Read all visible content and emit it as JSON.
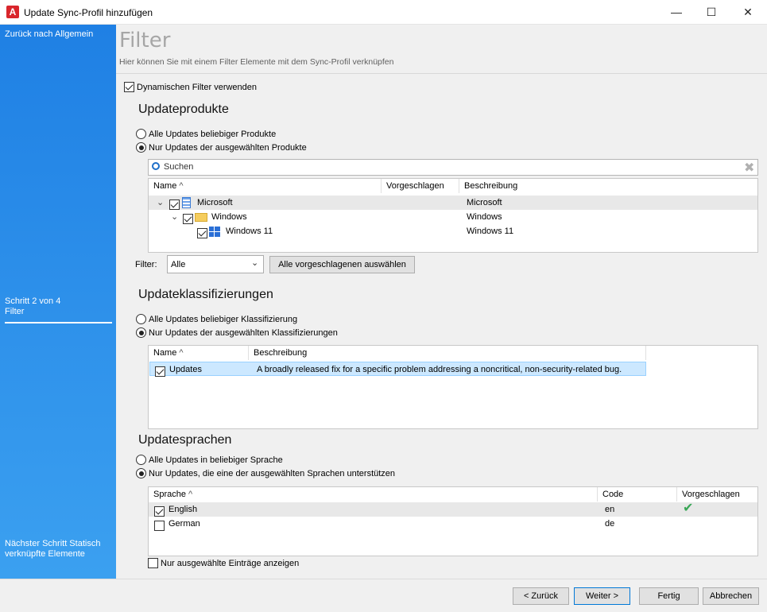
{
  "window": {
    "title": "Update Sync-Profil hinzufügen",
    "minimize": "—",
    "maximize": "☐",
    "close": "✕"
  },
  "sidebar": {
    "back_label": "Zurück nach Allgemein",
    "step_label": "Schritt 2 von 4",
    "step_name": "Filter",
    "next_label": "Nächster Schritt Statisch verknüpfte Elemente"
  },
  "header": {
    "title": "Filter",
    "subtitle": "Hier können Sie mit einem Filter Elemente mit dem Sync-Profil verknüpfen"
  },
  "dynamic_filter": {
    "label": "Dynamischen Filter verwenden",
    "checked": true
  },
  "products": {
    "heading": "Updateprodukte",
    "radio_all": "Alle Updates beliebiger Produkte",
    "radio_selected": "Nur Updates der ausgewählten Produkte",
    "search_placeholder": "Suchen",
    "columns": [
      "Name",
      "Vorgeschlagen",
      "Beschreibung"
    ],
    "rows": [
      {
        "name": "Microsoft",
        "description": "Microsoft",
        "icon": "building-icon"
      },
      {
        "name": "Windows",
        "description": "Windows",
        "icon": "folder-icon"
      },
      {
        "name": "Windows 11",
        "description": "Windows 11",
        "icon": "windows-logo-icon"
      }
    ],
    "filter_label": "Filter:",
    "filter_value": "Alle",
    "select_suggested_button": "Alle vorgeschlagenen auswählen"
  },
  "classifications": {
    "heading": "Updateklassifizierungen",
    "radio_all": "Alle Updates beliebiger Klassifizierung",
    "radio_selected": "Nur Updates der ausgewählten Klassifizierungen",
    "columns": [
      "Name",
      "Beschreibung"
    ],
    "rows": [
      {
        "name": "Updates",
        "description": "A broadly released fix for a specific problem addressing a noncritical, non-security-related bug."
      }
    ]
  },
  "languages": {
    "heading": "Updatesprachen",
    "radio_all": "Alle Updates in beliebiger Sprache",
    "radio_selected": "Nur Updates, die eine der ausgewählten Sprachen unterstützen",
    "columns": [
      "Sprache",
      "Code",
      "Vorgeschlagen"
    ],
    "rows": [
      {
        "name": "English",
        "code": "en",
        "checked": true,
        "suggested": true
      },
      {
        "name": "German",
        "code": "de",
        "checked": false,
        "suggested": false
      }
    ],
    "show_selected_label": "Nur ausgewählte Einträge anzeigen"
  },
  "footer": {
    "back": "< Zurück",
    "next": "Weiter >",
    "finish": "Fertig",
    "cancel": "Abbrechen"
  },
  "colors": {
    "sidebar": "#1f80e4",
    "selection": "#cce8ff",
    "check_green": "#3aa757"
  }
}
